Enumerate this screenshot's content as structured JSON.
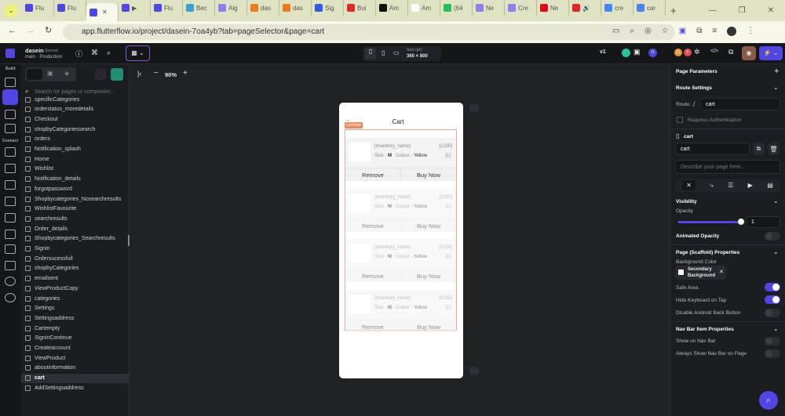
{
  "browser": {
    "tabs": [
      "Flu",
      "Flu",
      "",
      "▶",
      "Flu",
      "Bec",
      "Alg",
      "das",
      "das",
      "Sig",
      "Bui",
      "Am",
      "Am",
      "(64",
      "Ne",
      "Cre",
      "Ne",
      "🔊",
      "cre",
      "car"
    ],
    "url": "app.flutterflow.io/project/dasein-7oa4yb?tab=pageSelector&page=cart"
  },
  "app": {
    "project": "dasein",
    "synced": "Synced",
    "branch": "main",
    "env": "Production",
    "zoom": "90%",
    "size_label": "Size (px)",
    "size": "360 × 800",
    "version": "v1",
    "badge1": "11",
    "badge2": "6",
    "search_placeholder": "Search for pages or componen...",
    "rail_build": "Build",
    "rail_connect": "Connect"
  },
  "pages": [
    "specificCategories",
    "orderstatus_moredetails",
    "Checkout",
    "shopbyCategoriessearch",
    "orders",
    "Notification_splash",
    "Home",
    "Wishlist",
    "Notification_details",
    "forgotpassword",
    "Shopbycategories_Nosearchresults",
    "WishlistFavourite",
    "searchresults",
    "Order_details",
    "Shopbycategories_Searchresults",
    "Signin",
    "Ordersucessfull",
    "shopbyCategories",
    "emailsent",
    "ViewProductCopy",
    "categories",
    "Settings",
    "Settingsaddress",
    "Cartempty",
    "SigninContinue",
    "Createaccount",
    "ViewProduct",
    "aboutinformation",
    "cart",
    "AddSettingsaddress"
  ],
  "selected_page": "cart",
  "phone": {
    "title": "Cart",
    "listview_tag": "ListView",
    "card": {
      "name": "[inventory_name]",
      "price": "[1235]",
      "size_label": "Size - ",
      "size": "M",
      "colour_label": "Colour - ",
      "colour": "Yellow",
      "qty": "[1]",
      "remove": "Remove",
      "buy": "Buy Now"
    }
  },
  "props": {
    "page_params": "Page Parameters",
    "route_settings": "Route Settings",
    "route_label": "Route:",
    "route_slash": "/",
    "route": "cart",
    "requires_auth": "Requires Authentication",
    "page_name_header": "cart",
    "page_name": "cart",
    "describe_placeholder": "Describe your page here...",
    "visibility": "Visibility",
    "opacity": "Opacity",
    "opacity_value": "1",
    "opacity_fraction": 1,
    "animated_opacity": "Animated Opacity",
    "scaffold": "Page (Scaffold) Properties",
    "bg_color": "Background Color",
    "bg_value_1": "Secondary",
    "bg_value_2": "Background",
    "safe_area": "Safe Area",
    "hide_keyboard": "Hide Keyboard on Tap",
    "disable_back": "Disable Android Back Button",
    "nav_bar": "Nav Bar Item Properties",
    "show_nav": "Show on Nav Bar",
    "always_nav": "Always Show Nav Bar on Page"
  }
}
